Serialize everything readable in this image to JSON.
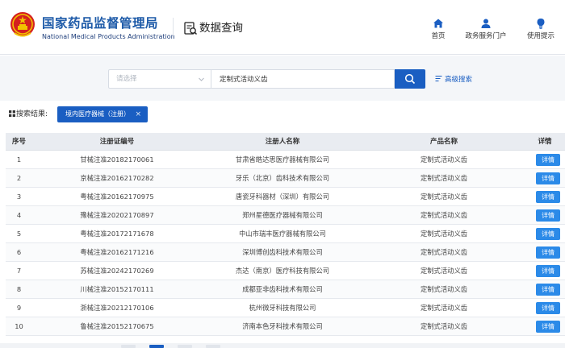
{
  "header": {
    "org_cn": "国家药品监督管理局",
    "org_en": "National Medical Products Administration",
    "section_title": "数据查询",
    "nav": [
      {
        "label": "首页",
        "icon": "home-icon"
      },
      {
        "label": "政务服务门户",
        "icon": "user-icon"
      },
      {
        "label": "使用提示",
        "icon": "lightbulb-icon"
      }
    ]
  },
  "search": {
    "select_placeholder": "请选择",
    "query_value": "定制式活动义齿",
    "advanced_label": "高级搜索"
  },
  "results": {
    "label": "搜索结果:",
    "filter_tag": "境内医疗器械（注册）",
    "tag_close": "×"
  },
  "table": {
    "columns": [
      "序号",
      "注册证编号",
      "注册人名称",
      "产品名称",
      "详情"
    ],
    "detail_label": "详情",
    "rows": [
      {
        "num": "1",
        "reg": "甘械注准20182170061",
        "name": "甘肃省皓达思医疗器械有限公司",
        "product": "定制式活动义齿"
      },
      {
        "num": "2",
        "reg": "京械注准20162170282",
        "name": "牙乐（北京）齿科技术有限公司",
        "product": "定制式活动义齿"
      },
      {
        "num": "3",
        "reg": "粤械注准20162170975",
        "name": "唐瓷牙科器材（深圳）有限公司",
        "product": "定制式活动义齿"
      },
      {
        "num": "4",
        "reg": "豫械注准20202170897",
        "name": "郑州星德医疗器械有限公司",
        "product": "定制式活动义齿"
      },
      {
        "num": "5",
        "reg": "粤械注准20172171678",
        "name": "中山市瑞丰医疗器械有限公司",
        "product": "定制式活动义齿"
      },
      {
        "num": "6",
        "reg": "粤械注准20162171216",
        "name": "深圳博创齿科技术有限公司",
        "product": "定制式活动义齿"
      },
      {
        "num": "7",
        "reg": "苏械注准20242170269",
        "name": "杰达（南京）医疗科技有限公司",
        "product": "定制式活动义齿"
      },
      {
        "num": "8",
        "reg": "川械注准20152170111",
        "name": "成都亚非齿科技术有限公司",
        "product": "定制式活动义齿"
      },
      {
        "num": "9",
        "reg": "浙械注准20212170106",
        "name": "杭州微牙科技有限公司",
        "product": "定制式活动义齿"
      },
      {
        "num": "10",
        "reg": "鲁械注准20152170675",
        "name": "济南本色牙科技术有限公司",
        "product": "定制式活动义齿"
      }
    ]
  },
  "colors": {
    "primary": "#1a5ec2",
    "detail_button": "#2b8ae8",
    "emblem_red": "#d4201f",
    "emblem_gold": "#f2c200"
  }
}
